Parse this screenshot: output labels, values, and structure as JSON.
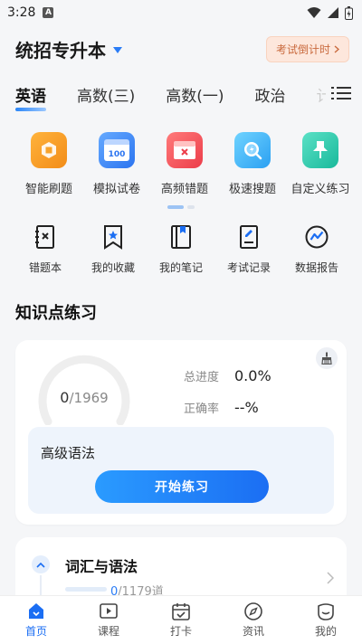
{
  "status": {
    "time": "3:28",
    "notif_badge": "A"
  },
  "header": {
    "title": "统招专升本",
    "countdown": "考试倒计时"
  },
  "tabs": [
    {
      "label": "英语",
      "active": true
    },
    {
      "label": "高数(三)",
      "active": false
    },
    {
      "label": "高数(一)",
      "active": false
    },
    {
      "label": "政治",
      "active": false
    },
    {
      "label": "计",
      "active": false
    }
  ],
  "features": [
    {
      "label": "智能刷题",
      "icon": "smart-practice-icon"
    },
    {
      "label": "模拟试卷",
      "icon": "mock-exam-icon",
      "badge": "100"
    },
    {
      "label": "高频错题",
      "icon": "frequent-mistakes-icon"
    },
    {
      "label": "极速搜题",
      "icon": "quick-search-icon"
    },
    {
      "label": "自定义练习",
      "icon": "custom-practice-icon"
    }
  ],
  "tools": [
    {
      "label": "错题本",
      "icon": "mistake-book-icon"
    },
    {
      "label": "我的收藏",
      "icon": "bookmark-icon"
    },
    {
      "label": "我的笔记",
      "icon": "notes-icon"
    },
    {
      "label": "考试记录",
      "icon": "exam-record-icon"
    },
    {
      "label": "数据报告",
      "icon": "data-report-icon"
    }
  ],
  "practice": {
    "section_title": "知识点练习",
    "done": "0",
    "total": "/1969",
    "progress_label": "总进度",
    "progress_value": "0.0%",
    "accuracy_label": "正确率",
    "accuracy_value": "--%",
    "topic": "高级语法",
    "start_label": "开始练习"
  },
  "chapter": {
    "title": "词汇与语法",
    "done": "0",
    "total": "/1179道",
    "progress": 0
  },
  "bottom_nav": [
    {
      "label": "首页",
      "icon": "home-icon",
      "active": true
    },
    {
      "label": "课程",
      "icon": "course-icon",
      "active": false
    },
    {
      "label": "打卡",
      "icon": "checkin-icon",
      "active": false
    },
    {
      "label": "资讯",
      "icon": "compass-icon",
      "active": false
    },
    {
      "label": "我的",
      "icon": "profile-icon",
      "active": false
    }
  ],
  "colors": {
    "accent": "#1b6ef3",
    "countdown_bg": "#fde7dc",
    "countdown_text": "#c96a3e"
  }
}
